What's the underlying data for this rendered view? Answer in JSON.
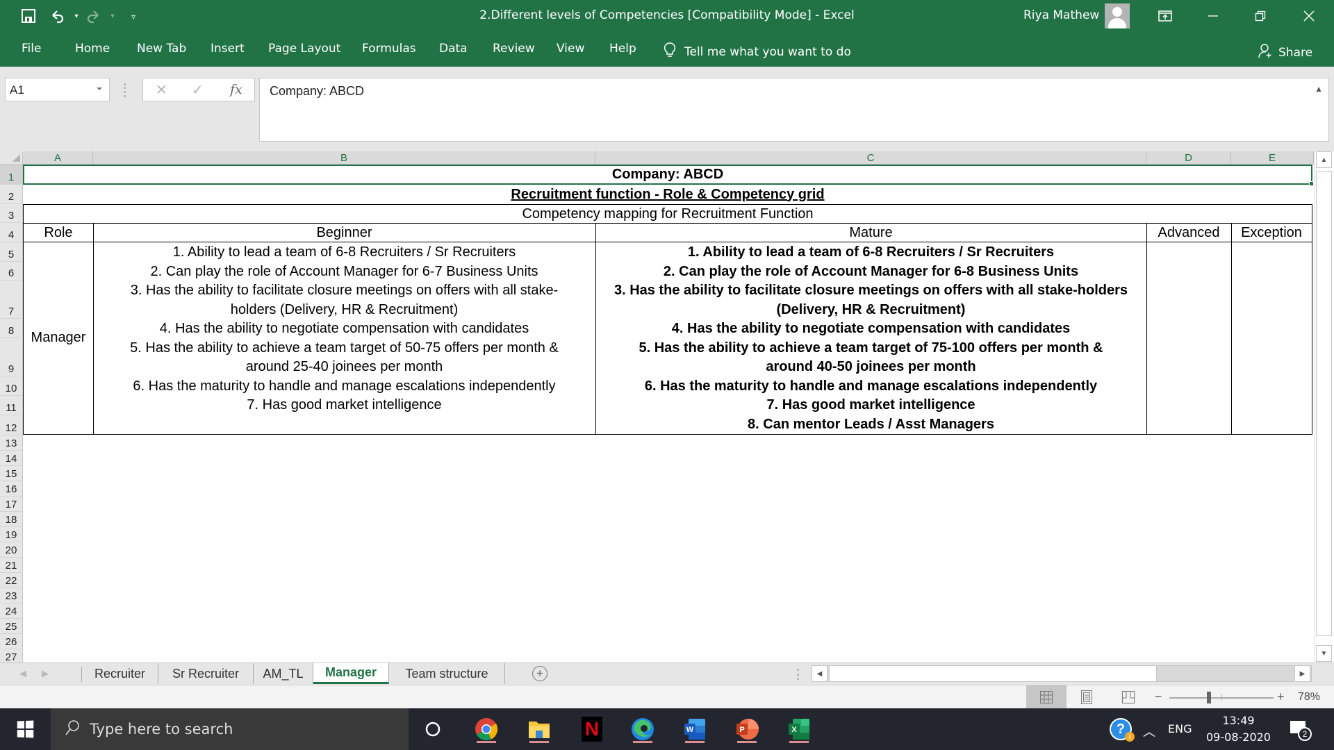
{
  "window": {
    "title": "2.Different levels of Competencies  [Compatibility Mode]  -  Excel",
    "user": "Riya Mathew",
    "accent": "#217346"
  },
  "qat": {
    "save": "save-icon",
    "undo": "undo-icon",
    "redo": "redo-icon",
    "customize": "customize-qat-icon"
  },
  "ribbon": {
    "tabs": [
      "File",
      "Home",
      "New Tab",
      "Insert",
      "Page Layout",
      "Formulas",
      "Data",
      "Review",
      "View",
      "Help"
    ],
    "tell_me": "Tell me what you want to do",
    "share": "Share"
  },
  "formula_bar": {
    "name_box": "A1",
    "cancel": "✕",
    "enter": "✓",
    "fx": "fx",
    "value": "Company: ABCD"
  },
  "grid": {
    "columns": [
      "A",
      "B",
      "C",
      "D",
      "E"
    ],
    "rows": [
      "1",
      "2",
      "3",
      "4",
      "5",
      "6",
      "7",
      "8",
      "9",
      "10",
      "11",
      "12",
      "13",
      "14",
      "15",
      "16",
      "17",
      "18",
      "19",
      "20",
      "21",
      "22",
      "23",
      "24",
      "25",
      "26",
      "27"
    ],
    "selected_cell": "A1",
    "title": "Company: ABCD",
    "subtitle": "Recruitment function - Role & Competency grid",
    "mapping": "Competency mapping for Recruitment Function",
    "headers": {
      "role": "Role",
      "beginner": "Beginner",
      "mature": "Mature",
      "advanced": "Advanced",
      "exception": "Exception"
    },
    "role": "Manager",
    "beginner": [
      "1. Ability to lead a team of 6-8 Recruiters / Sr Recruiters",
      "2. Can play the role of Account Manager for 6-7 Business Units",
      "3. Has the ability to facilitate closure meetings on offers with all stake-",
      "holders (Delivery, HR & Recruitment)",
      "4. Has the ability to negotiate compensation with candidates",
      "5. Has the ability to achieve a team target of 50-75 offers per month &",
      "around 25-40 joinees per month",
      "6. Has the maturity to handle and manage escalations independently",
      "7. Has good market intelligence"
    ],
    "mature": [
      "1. Ability to lead a team of 6-8 Recruiters / Sr Recruiters",
      "2. Can play the role of Account Manager for 6-8 Business Units",
      "3. Has the ability to facilitate closure meetings on offers with all stake-holders",
      "(Delivery, HR & Recruitment)",
      "4. Has the ability to negotiate compensation with candidates",
      "5. Has the ability to achieve a team target of 75-100 offers per month &",
      "around 40-50 joinees per month",
      "6. Has the maturity to handle and manage escalations independently",
      "7. Has good market intelligence",
      "8. Can mentor Leads / Asst Managers"
    ],
    "advanced": "",
    "exception": ""
  },
  "sheets": {
    "tabs": [
      "Recruiter",
      "Sr Recruiter",
      "AM_TL",
      "Manager",
      "Team structure"
    ],
    "active": "Manager",
    "add": "+"
  },
  "status_bar": {
    "views": [
      "normal-view-icon",
      "page-layout-view-icon",
      "page-break-preview-icon"
    ],
    "zoom_percent": 78,
    "zoom_label": "78%",
    "minus": "−",
    "plus": "+"
  },
  "taskbar": {
    "search_placeholder": "Type here to search",
    "apps": [
      "cortana",
      "chrome",
      "file-explorer",
      "netflix",
      "edge",
      "word",
      "powerpoint",
      "excel"
    ],
    "language": "ENG",
    "time": "13:49",
    "date": "09-08-2020",
    "notifications": "2"
  }
}
